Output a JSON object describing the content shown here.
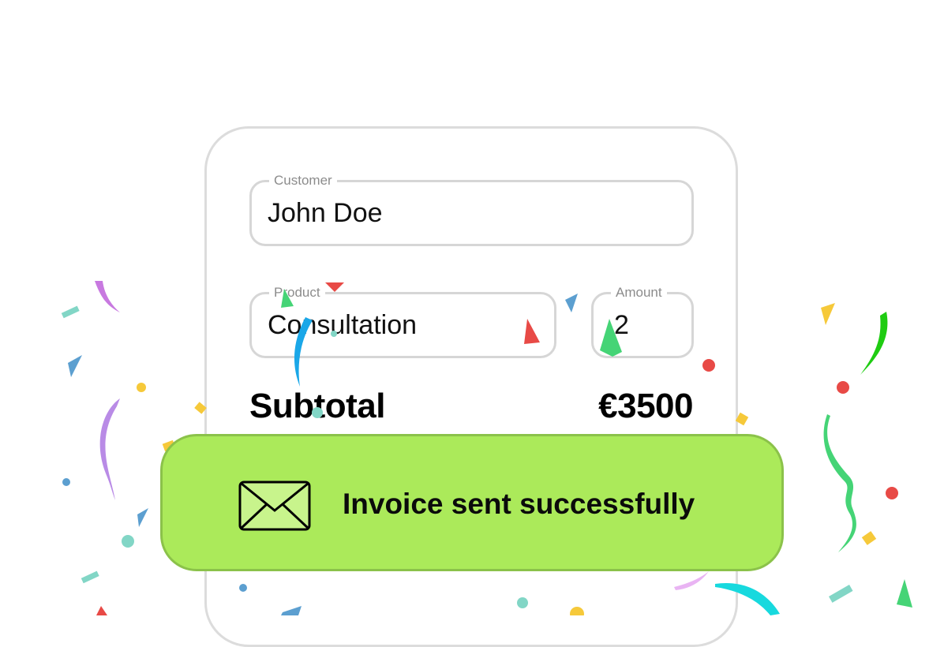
{
  "form": {
    "customer": {
      "label": "Customer",
      "value": "John Doe"
    },
    "product": {
      "label": "Product",
      "value": "Consultation"
    },
    "amount": {
      "label": "Amount",
      "value": "2"
    },
    "subtotal": {
      "label": "Subtotal",
      "value": "€3500"
    }
  },
  "toast": {
    "message": "Invoice sent successfully",
    "icon": "envelope-icon",
    "color": "#abea5a"
  }
}
